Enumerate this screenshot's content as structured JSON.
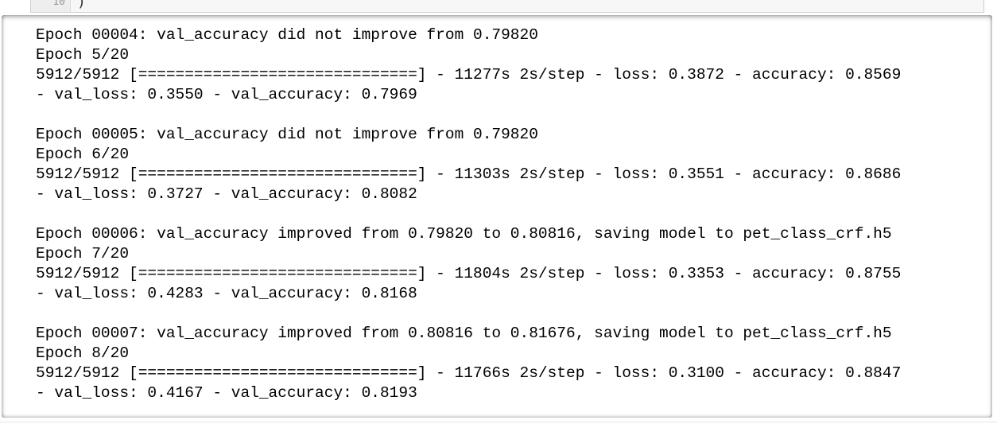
{
  "input_cell": {
    "gutter_text": "10",
    "code_tail": ")"
  },
  "output": {
    "lines": [
      "Epoch 00004: val_accuracy did not improve from 0.79820",
      "Epoch 5/20",
      "5912/5912 [==============================] - 11277s 2s/step - loss: 0.3872 - accuracy: 0.8569",
      "- val_loss: 0.3550 - val_accuracy: 0.7969",
      "",
      "Epoch 00005: val_accuracy did not improve from 0.79820",
      "Epoch 6/20",
      "5912/5912 [==============================] - 11303s 2s/step - loss: 0.3551 - accuracy: 0.8686",
      "- val_loss: 0.3727 - val_accuracy: 0.8082",
      "",
      "Epoch 00006: val_accuracy improved from 0.79820 to 0.80816, saving model to pet_class_crf.h5",
      "Epoch 7/20",
      "5912/5912 [==============================] - 11804s 2s/step - loss: 0.3353 - accuracy: 0.8755",
      "- val_loss: 0.4283 - val_accuracy: 0.8168",
      "",
      "Epoch 00007: val_accuracy improved from 0.80816 to 0.81676, saving model to pet_class_crf.h5",
      "Epoch 8/20",
      "5912/5912 [==============================] - 11766s 2s/step - loss: 0.3100 - accuracy: 0.8847",
      "- val_loss: 0.4167 - val_accuracy: 0.8193"
    ]
  }
}
